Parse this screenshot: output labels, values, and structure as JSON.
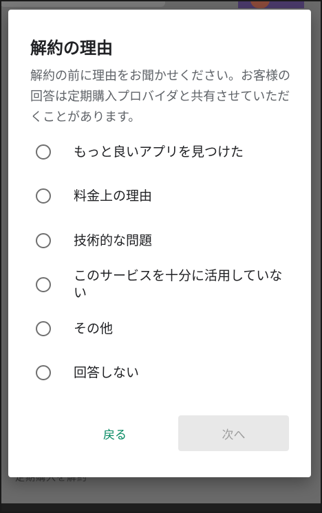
{
  "background": {
    "bottom_text": "定期購入を解約"
  },
  "dialog": {
    "title": "解約の理由",
    "description": "解約の前に理由をお聞かせください。お客様の回答は定期購入プロバイダと共有させていただくことがあります。",
    "options": [
      {
        "label": "もっと良いアプリを見つけた",
        "selected": false
      },
      {
        "label": "料金上の理由",
        "selected": false
      },
      {
        "label": "技術的な問題",
        "selected": false
      },
      {
        "label": "このサービスを十分に活用していない",
        "selected": false
      },
      {
        "label": "その他",
        "selected": false
      },
      {
        "label": "回答しない",
        "selected": false
      }
    ],
    "back_label": "戻る",
    "next_label": "次へ",
    "next_enabled": false
  },
  "colors": {
    "accent": "#01875f",
    "disabled_button_bg": "#e8e8e8",
    "disabled_button_text": "#9e9e9e",
    "scrim": "#6a6a6a"
  }
}
